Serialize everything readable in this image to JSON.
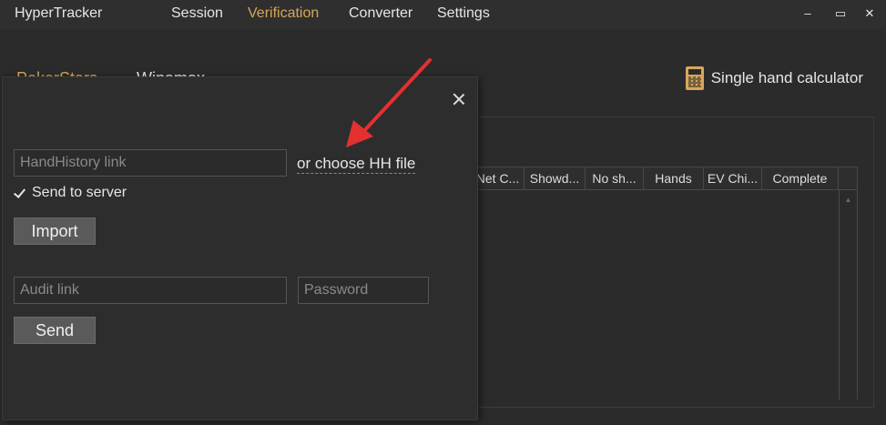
{
  "app": {
    "title": "HyperTracker"
  },
  "menu": [
    {
      "label": "Session"
    },
    {
      "label": "Verification"
    },
    {
      "label": "Converter"
    },
    {
      "label": "Settings"
    }
  ],
  "window_controls": {
    "minimize": "–",
    "maximize": "▭",
    "close": "✕"
  },
  "sites": {
    "active": "PokerStars",
    "inactive": "Winamax"
  },
  "calculator": {
    "label": "Single hand calculator"
  },
  "table": {
    "columns": [
      "Net C...",
      "Showd...",
      "No sh...",
      "Hands",
      "EV Chi...",
      "Complete"
    ]
  },
  "dialog": {
    "hh_link_placeholder": "HandHistory link",
    "choose_file": "or choose HH file",
    "send_to_server": "Send to server",
    "import_label": "Import",
    "audit_placeholder": "Audit link",
    "password_placeholder": "Password",
    "send_label": "Send"
  },
  "colors": {
    "accent": "#d8a65a",
    "annotation_arrow": "#e53030"
  }
}
